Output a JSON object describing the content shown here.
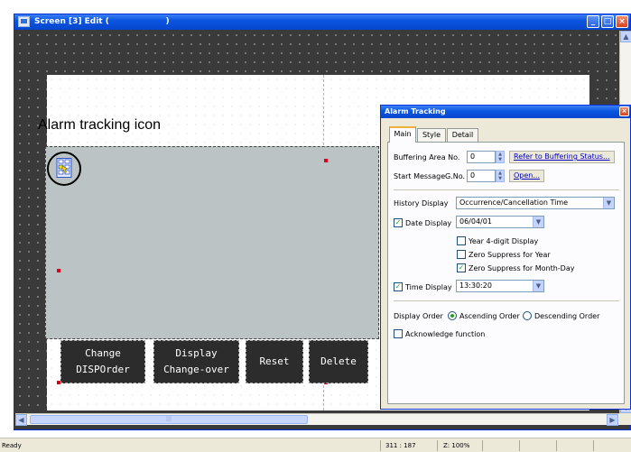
{
  "window": {
    "title": "Screen [3] Edit (                    )",
    "min_glyph": "_",
    "max_glyph": "□",
    "close_glyph": "×"
  },
  "canvas": {
    "caption": "Alarm tracking icon"
  },
  "switches": [
    {
      "line1": "Change",
      "line2": "DISPOrder"
    },
    {
      "line1": "Display",
      "line2": "Change-over"
    },
    {
      "line1": "Reset",
      "line2": ""
    },
    {
      "line1": "Delete",
      "line2": ""
    }
  ],
  "dialog": {
    "title": "Alarm Tracking",
    "close_glyph": "×",
    "tabs": [
      {
        "label": "Main",
        "active": true
      },
      {
        "label": "Style",
        "active": false
      },
      {
        "label": "Detail",
        "active": false
      }
    ],
    "buffering_area_label": "Buffering Area No.",
    "buffering_area_value": "0",
    "refer_button": "Refer to Buffering Status...",
    "start_message_label": "Start Message",
    "g_no_label": "G.No.",
    "g_no_value": "0",
    "open_button": "Open...",
    "history_display_label": "History Display",
    "history_display_value": "Occurrence/Cancellation Time",
    "date_display_label": "Date Display",
    "date_display_checked": true,
    "date_display_value": "06/04/01",
    "year4_label": "Year 4-digit Display",
    "year4_checked": false,
    "zero_year_label": "Zero Suppress for Year",
    "zero_year_checked": false,
    "zero_monthday_label": "Zero Suppress for Month-Day",
    "zero_monthday_checked": true,
    "time_display_label": "Time Display",
    "time_display_checked": true,
    "time_display_value": "13:30:20",
    "display_order_label": "Display Order",
    "order_ascending_label": "Ascending Order",
    "order_descending_label": "Descending Order",
    "order_selected": "ascending",
    "ack_label": "Acknowledge function",
    "ack_checked": false
  },
  "scroll": {
    "up": "▲",
    "down": "▼",
    "left": "◀",
    "right": "▶",
    "thumb_grip": "|||"
  },
  "status": {
    "text": "Ready",
    "coords": "311 : 187",
    "zoom": "Z: 100%"
  },
  "colors": {
    "titlebar": "#0a55e0",
    "workarea": "#3a3a3a",
    "history_area": "#bcc3c4",
    "switch_bg": "#2c2c2c",
    "dialog_bg": "#ece9d8",
    "check_mark": "#21a121"
  }
}
